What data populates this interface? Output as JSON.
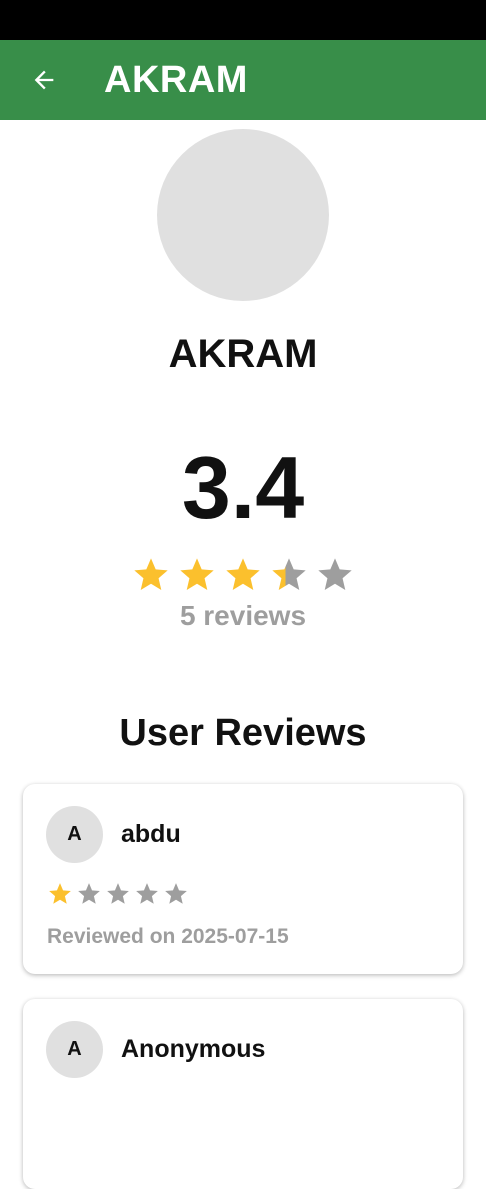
{
  "app_bar": {
    "title": "AKRAM",
    "back_icon": "arrow-left-icon",
    "background": "#388e49"
  },
  "profile": {
    "name": "AKRAM",
    "rating": "3.4",
    "rating_value": 3.4,
    "rating_max": 5,
    "review_count": "5 reviews"
  },
  "section": {
    "title": "User Reviews"
  },
  "reviews": [
    {
      "initial": "A",
      "name": "abdu",
      "stars": 1,
      "date": "Reviewed on 2025-07-15"
    },
    {
      "initial": "A",
      "name": "Anonymous",
      "stars": null,
      "date": ""
    }
  ],
  "colors": {
    "star_filled": "#fbc02d",
    "star_empty": "#9e9e9e"
  }
}
